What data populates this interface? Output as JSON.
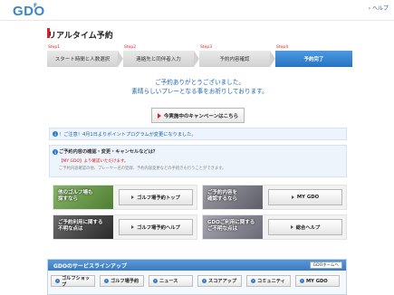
{
  "header": {
    "logo": "GDO",
    "logo_suffix": "F",
    "help_link": "› ヘルプ"
  },
  "page_title": "リアルタイム予約",
  "steps": [
    {
      "num": "Step1",
      "label": "スタート時間と人数選択"
    },
    {
      "num": "Step2",
      "label": "連絡先と同伴者入力"
    },
    {
      "num": "Step3",
      "label": "予約内容確認"
    },
    {
      "num": "Step4",
      "label": "予約完了",
      "active": true
    }
  ],
  "thanks": {
    "line1": "ご予約ありがとうございました。",
    "line2": "素晴らしいプレーとなる事をお祈りしております。"
  },
  "campaign_button": "今実施中のキャンペーンはこちら",
  "notice1": "！ご注意！4月1日よりポイントプログラムが変更になりました。",
  "notice2": {
    "title": "ご予約内容の確認・変更・キャンセルなどは？",
    "red_text": "【MY GDO】より確認いただけます。",
    "grey_text": "ご予約内容確認の他、プレーヤー名の登録、予約内容変更などの手続きも行うことができます。"
  },
  "banners": [
    {
      "img_text_1": "他のゴルフ場も",
      "img_text_2": "探すなら",
      "button": "ゴルフ場予約トップ",
      "img_color": "#6f9c4e"
    },
    {
      "img_text_1": "ご予約内容を",
      "img_text_2": "確認するなら",
      "button": "MY GDO",
      "img_color": "#7d7d86"
    },
    {
      "img_text_1": "ご予約利用に関する",
      "img_text_2": "不明な点は",
      "button": "ゴルフ場予約ヘルプ",
      "img_color": "#4d4d4d"
    },
    {
      "img_text_1": "GDOご利用に関する",
      "img_text_2": "ご不明な点は",
      "button": "総合ヘルプ",
      "img_color": "#8a8a96"
    }
  ],
  "lineup": {
    "title": "GDOのサービスラインアップ",
    "home_button": "GDOホームへ",
    "items": [
      "ゴルフショップ",
      "ゴルフ場予約",
      "ニュース",
      "スコアアップ",
      "コミュニティ",
      "MY GDO"
    ]
  },
  "colors": {
    "accent_blue": "#1e62b4",
    "active_step": "#2673c2",
    "alert_red": "#d8232a"
  }
}
